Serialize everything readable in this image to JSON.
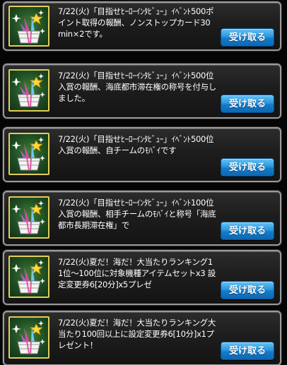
{
  "messages": [
    {
      "text": "7/22(火)「目指せﾋｰﾛｰｲﾝﾀﾋﾞｭｰ」ｲﾍﾞﾝﾄ500ポイント取得の報酬、ノンストップカード30min×2です。",
      "button": "受け取る",
      "icon": "gift-box-icon"
    },
    {
      "text": "7/22(火)「目指せﾋｰﾛｰｲﾝﾀﾋﾞｭｰ」ｲﾍﾞﾝﾄ500位入賞の報酬、海底都市滞在権の称号を付与しました。",
      "button": "受け取る",
      "icon": "gift-box-icon"
    },
    {
      "text": "7/22(火)「目指せﾋｰﾛｰｲﾝﾀﾋﾞｭｰ」ｲﾍﾞﾝﾄ500位入賞の報酬、自チームのﾓﾊﾞｲです",
      "button": "受け取る",
      "icon": "gift-box-icon"
    },
    {
      "text": "7/22(火)「目指せﾋｰﾛｰｲﾝﾀﾋﾞｭｰ」ｲﾍﾞﾝﾄ100位入賞の報酬、相手チームのﾓﾊﾞｲと称号「海底都市長期滞在権」で",
      "button": "受け取る",
      "icon": "gift-box-icon"
    },
    {
      "text": "7/22(火)夏だ！海だ！大当たりランキング11位〜100位に対象機種アイテムセットx3 設定変更券6[20分]x5プレゼ",
      "button": "受け取る",
      "icon": "gift-box-icon"
    },
    {
      "text": "7/22(火)夏だ！海だ！大当たりランキング大当たり100回以上に設定変更券6[10分]x1プレゼント！",
      "button": "受け取る",
      "icon": "gift-box-icon"
    }
  ],
  "colors": {
    "button": "#1a86d2",
    "icon_frame": "#e1cd5a",
    "icon_bg": "#2a6a2c",
    "card_border": "#9a9a9a"
  }
}
